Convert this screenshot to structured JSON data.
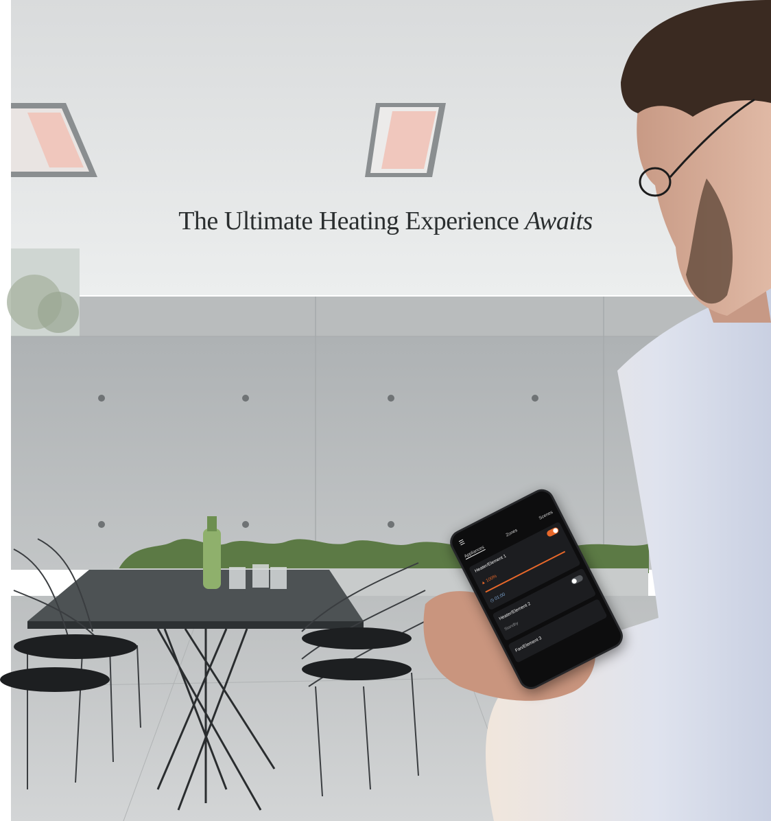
{
  "headline": {
    "main": "The Ultimate Heating Experience",
    "emphasis": "Awaits"
  },
  "phone_app": {
    "tabs": [
      "Appliances",
      "Zones",
      "Scenes"
    ],
    "active_tab": "Appliances",
    "appliances": [
      {
        "name": "Heater/Element 1",
        "level": "100%",
        "on": true,
        "timer": "01:00"
      },
      {
        "name": "Heater/Element 2",
        "status": "Standby",
        "on": false
      },
      {
        "name": "Fan/Element 3"
      }
    ],
    "accent_color": "#e8682a"
  },
  "colors": {
    "ceiling": "#dfe1e1",
    "concrete": "#b5b9bb",
    "floor": "#c6c9ca",
    "heater_glow": "#f0c7bd"
  }
}
